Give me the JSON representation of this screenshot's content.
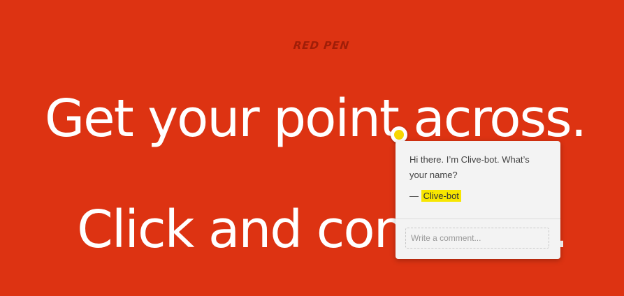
{
  "logo": {
    "text": "RED PEN"
  },
  "headlines": [
    "Get your point across.",
    "Click and comment."
  ],
  "comment_popup": {
    "message": "Hi there. I’m Clive-bot. What’s your name?",
    "author_prefix": "—",
    "author": "Clive-bot",
    "input_placeholder": "Write a comment..."
  },
  "colors": {
    "background": "#dd3312",
    "logo": "#a01e08",
    "highlight": "#f7e600",
    "marker": "#f7d600"
  }
}
